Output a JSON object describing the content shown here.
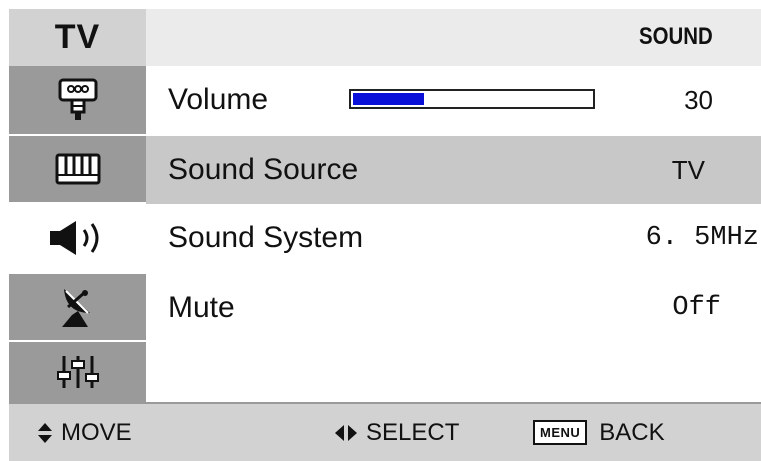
{
  "window": {
    "title": "TV"
  },
  "header": {
    "title": "SOUND"
  },
  "sidebar": {
    "icons": [
      "tv-connector-icon",
      "keyboard-icon",
      "speaker-icon",
      "satellite-icon",
      "equalizer-icon"
    ]
  },
  "rows": [
    {
      "label": "Volume",
      "value": "30"
    },
    {
      "label": "Sound Source",
      "value": "TV"
    },
    {
      "label": "Sound System",
      "value": "6. 5MHz"
    },
    {
      "label": "Mute",
      "value": "Off"
    }
  ],
  "volume": {
    "level_percent": 30
  },
  "footer": {
    "move_label": "MOVE",
    "select_label": "SELECT",
    "menu_key": "MENU",
    "back_label": "BACK"
  },
  "colors": {
    "header_bg": "#d2d2d2",
    "selected_row_bg": "#c8c8c8",
    "volume_fill": "#0a10d8"
  }
}
